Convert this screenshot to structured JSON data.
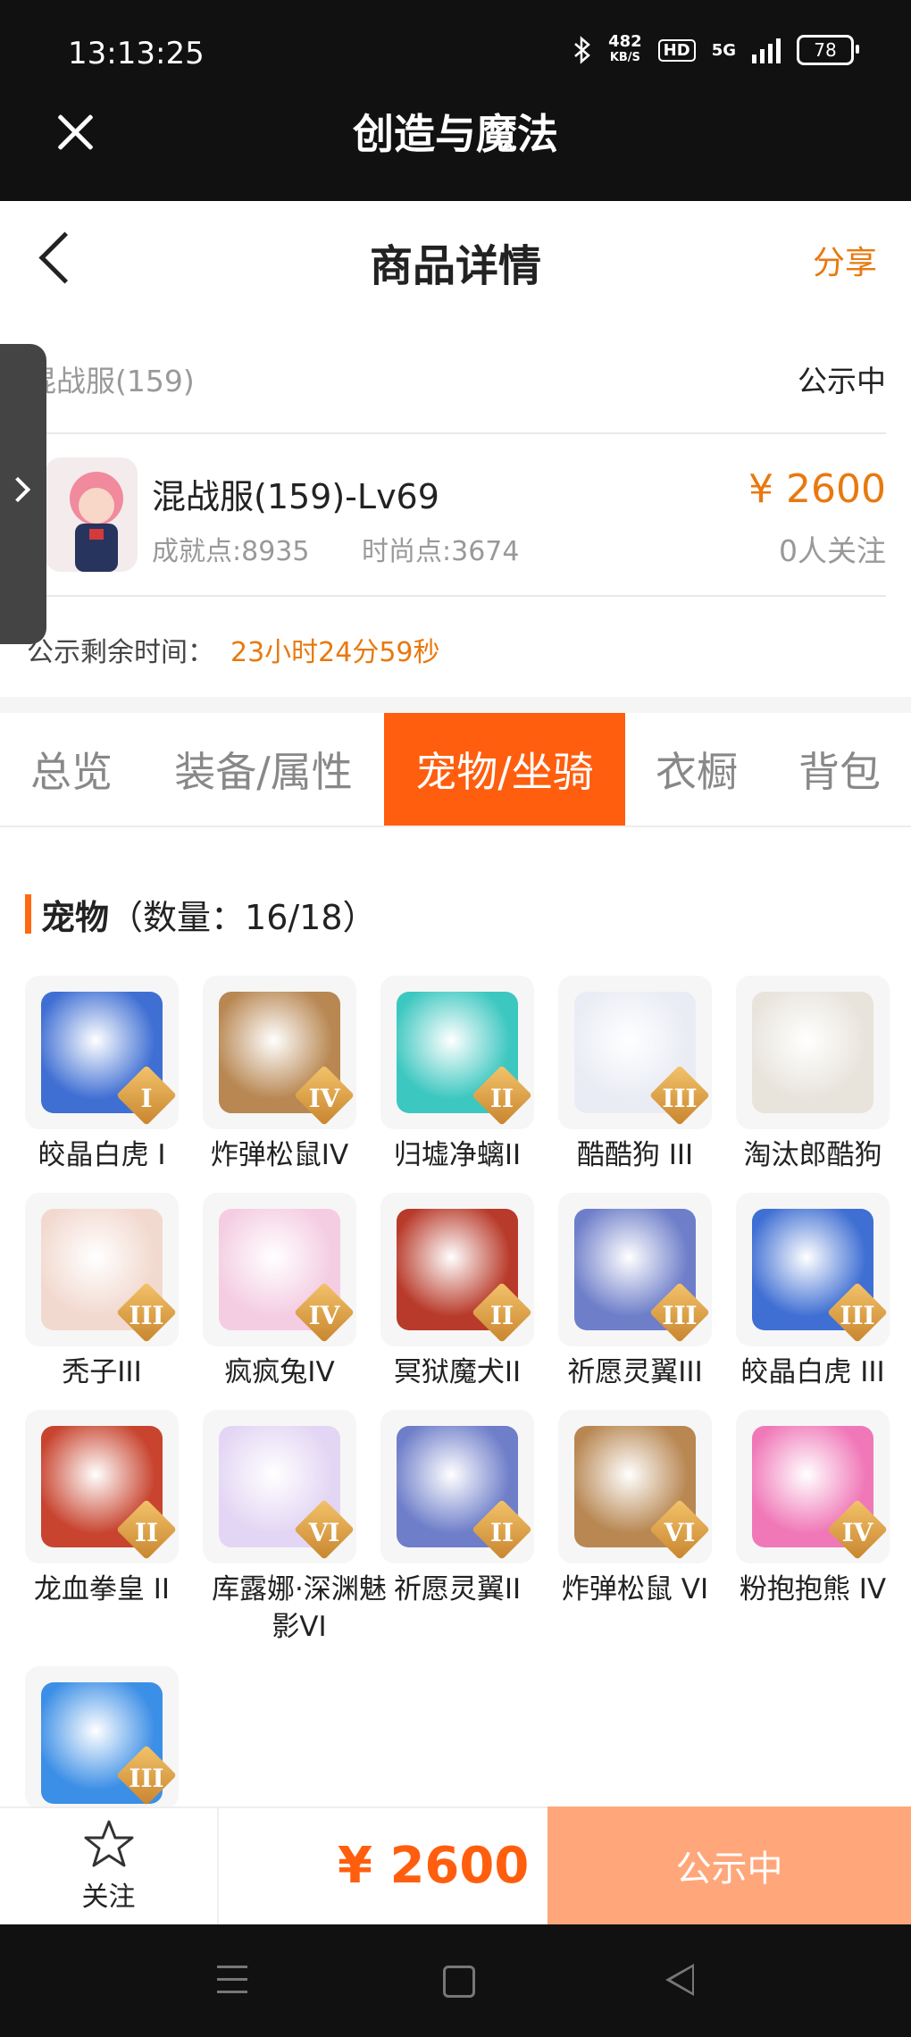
{
  "status_bar": {
    "time": "13:13:25",
    "net_speed": "482",
    "net_unit": "KB/S",
    "hd": "HD",
    "network": "5G",
    "battery": "78"
  },
  "app": {
    "title": "创造与魔法"
  },
  "page": {
    "title": "商品详情",
    "share": "分享"
  },
  "listing": {
    "server": "混战服(159)",
    "status": "公示中",
    "character_name": "混战服(159)-Lv69",
    "achievement": "成就点:8935",
    "fashion": "时尚点:3674",
    "price": "¥ 2600",
    "followers": "0人关注",
    "remaining_label": "公示剩余时间：",
    "remaining_value": "23小时24分59秒"
  },
  "tabs": [
    {
      "label": "总览"
    },
    {
      "label": "装备/属性"
    },
    {
      "label": "宠物/坐骑",
      "active": true
    },
    {
      "label": "衣橱"
    },
    {
      "label": "背包"
    }
  ],
  "pets_section": {
    "title": "宠物",
    "count": "（数量：16/18）"
  },
  "pets": [
    {
      "name": "皎晶白虎 I",
      "tier": "I",
      "color": "#3f6fd3"
    },
    {
      "name": "炸弹松鼠IV",
      "tier": "IV",
      "color": "#b88752"
    },
    {
      "name": "归墟净螭II",
      "tier": "II",
      "color": "#3cc7c0"
    },
    {
      "name": "酷酷狗 III",
      "tier": "III",
      "color": "#e9ecf4"
    },
    {
      "name": "淘汰郎酷狗",
      "tier": "",
      "color": "#e8e4dc"
    },
    {
      "name": "秃子III",
      "tier": "III",
      "color": "#f2d9cf"
    },
    {
      "name": "疯疯兔IV",
      "tier": "IV",
      "color": "#f4cde2"
    },
    {
      "name": "冥狱魔犬II",
      "tier": "II",
      "color": "#b83a2a"
    },
    {
      "name": "祈愿灵翼III",
      "tier": "III",
      "color": "#6e7ec9"
    },
    {
      "name": "皎晶白虎 III",
      "tier": "III",
      "color": "#3f6fd3"
    },
    {
      "name": "龙血拳皇 II",
      "tier": "II",
      "color": "#c8442f"
    },
    {
      "name": "库露娜·深渊魅影VI",
      "tier": "VI",
      "color": "#e3d6f4"
    },
    {
      "name": "祈愿灵翼II",
      "tier": "II",
      "color": "#6e7ec9"
    },
    {
      "name": "炸弹松鼠 VI",
      "tier": "VI",
      "color": "#b88752"
    },
    {
      "name": "粉抱抱熊 IV",
      "tier": "IV",
      "color": "#f078b8"
    },
    {
      "name": "",
      "tier": "III",
      "color": "#3c8fe6"
    }
  ],
  "bottom_bar": {
    "follow": "关注",
    "price": "¥ 2600",
    "status_button": "公示中"
  },
  "colors": {
    "accent": "#ff5e0e",
    "price": "#e8790f",
    "status_button": "#ffa77a"
  }
}
